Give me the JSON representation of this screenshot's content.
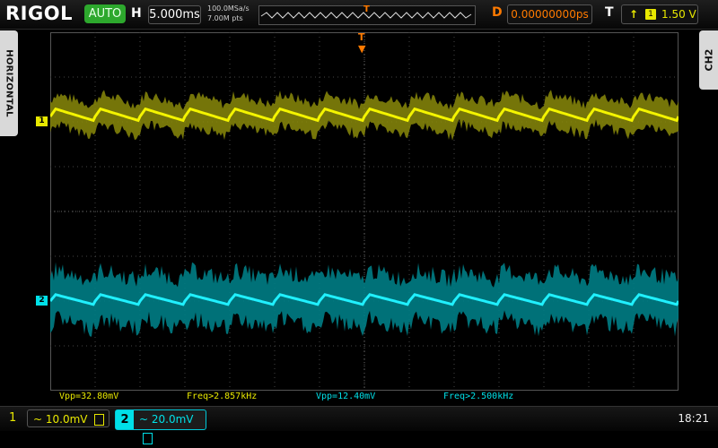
{
  "brand": "RIGOL",
  "status": "AUTO",
  "horizontal": {
    "label": "H",
    "timebase": "5.000ms",
    "sample_rate": "100.0MSa/s",
    "memory_depth": "7.00M pts"
  },
  "delay": {
    "label": "D",
    "value": "0.00000000ps"
  },
  "trigger": {
    "label": "T",
    "source": "1",
    "level": "1.50 V",
    "edge_icon": "rising-edge-icon",
    "color": "#e8e800"
  },
  "side_tabs": {
    "left": "HORIZONTAL",
    "right": "CH2"
  },
  "channels": [
    {
      "number": "1",
      "color": "#e8e800",
      "scale": "10.0mV",
      "coupling": "~",
      "marker": "1"
    },
    {
      "number": "2",
      "color": "#00e0e8",
      "scale": "20.0mV",
      "coupling": "~",
      "marker": "2"
    }
  ],
  "measurements": {
    "ch1_vpp": "Vpp=32.80mV",
    "ch1_freq": "Freq>2.857kHz",
    "ch2_vpp": "Vpp=12.40mV",
    "ch2_freq": "Freq>2.500kHz"
  },
  "clock": "18:21"
}
